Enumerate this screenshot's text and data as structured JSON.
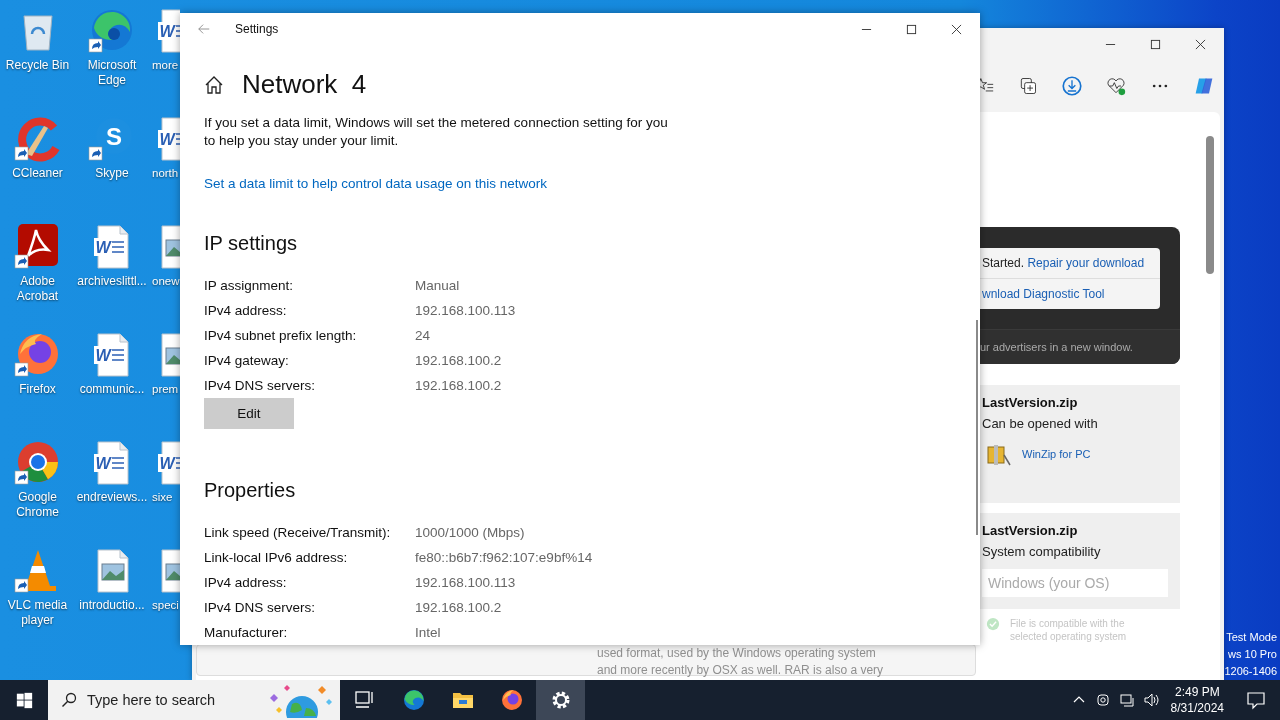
{
  "desktop": {
    "icons": [
      {
        "label": "Recycle Bin",
        "kind": "recycle-bin",
        "shortcut": false
      },
      {
        "label": "Microsoft Edge",
        "kind": "edge",
        "shortcut": true
      },
      {
        "label": "more",
        "kind": "word",
        "shortcut": false,
        "glyph": "W"
      },
      {
        "label": "CCleaner",
        "kind": "ccleaner",
        "shortcut": true
      },
      {
        "label": "Skype",
        "kind": "skype",
        "shortcut": true,
        "glyph": "S"
      },
      {
        "label": "north",
        "kind": "word",
        "shortcut": false,
        "glyph": "W"
      },
      {
        "label": "Adobe Acrobat",
        "kind": "acrobat",
        "shortcut": true
      },
      {
        "label": "archiveslittl...",
        "kind": "word",
        "shortcut": false,
        "glyph": "W"
      },
      {
        "label": "onew",
        "kind": "image",
        "shortcut": false
      },
      {
        "label": "Firefox",
        "kind": "firefox",
        "shortcut": true
      },
      {
        "label": "communic...",
        "kind": "word",
        "shortcut": false,
        "glyph": "W"
      },
      {
        "label": "prem",
        "kind": "image",
        "shortcut": false
      },
      {
        "label": "Google Chrome",
        "kind": "chrome",
        "shortcut": true
      },
      {
        "label": "endreviews...",
        "kind": "word",
        "shortcut": false,
        "glyph": "W"
      },
      {
        "label": "sixe",
        "kind": "word",
        "shortcut": false,
        "glyph": "W"
      },
      {
        "label": "VLC media player",
        "kind": "vlc",
        "shortcut": true
      },
      {
        "label": "introductio...",
        "kind": "image",
        "shortcut": false
      },
      {
        "label": "speci",
        "kind": "image",
        "shortcut": false
      }
    ],
    "system_text": [
      "Test Mode",
      "ws 10 Pro",
      "1206-1406"
    ]
  },
  "browser_window": {
    "toolbar": [
      {
        "kind": "favorites"
      },
      {
        "kind": "collections"
      },
      {
        "kind": "downloads"
      },
      {
        "kind": "health"
      },
      {
        "kind": "more"
      },
      {
        "kind": "copilot"
      }
    ],
    "promo": {
      "text": "Started.",
      "link": "Repair your download",
      "second_link": "wnload Diagnostic Tool",
      "footer": "ur advertisers in a new window."
    },
    "file_card": {
      "name": "LastVersion.zip",
      "subtitle": "Can be opened with",
      "app": "WinZip for PC"
    },
    "compat_card": {
      "name": "LastVersion.zip",
      "subtitle": "System compatibility",
      "select": "Windows (your OS)",
      "note": "File is compatible with the selected operating system"
    },
    "description": [
      "used format, used by the Windows operating system",
      "and more recently by OSX as well. RAR is also a very"
    ]
  },
  "settings_window": {
    "title": "Settings",
    "page_title": "Network  4",
    "intro": "If you set a data limit, Windows will set the metered connection setting for you to help you stay under your limit.",
    "data_limit_link": "Set a data limit to help control data usage on this network",
    "ip_settings": {
      "heading": "IP settings",
      "rows": [
        {
          "label": "IP assignment:",
          "value": "Manual"
        },
        {
          "label": "IPv4 address:",
          "value": "192.168.100.113"
        },
        {
          "label": "IPv4 subnet prefix length:",
          "value": "24"
        },
        {
          "label": "IPv4 gateway:",
          "value": "192.168.100.2"
        },
        {
          "label": "IPv4 DNS servers:",
          "value": "192.168.100.2"
        }
      ],
      "edit_button": "Edit"
    },
    "properties": {
      "heading": "Properties",
      "rows": [
        {
          "label": "Link speed (Receive/Transmit):",
          "value": "1000/1000 (Mbps)"
        },
        {
          "label": "Link-local IPv6 address:",
          "value": "fe80::b6b7:f962:107:e9bf%14"
        },
        {
          "label": "IPv4 address:",
          "value": "192.168.100.113"
        },
        {
          "label": "IPv4 DNS servers:",
          "value": "192.168.100.2"
        },
        {
          "label": "Manufacturer:",
          "value": "Intel"
        }
      ]
    }
  },
  "taskbar": {
    "search_placeholder": "Type here to search",
    "apps": [
      {
        "kind": "task-view",
        "selected": false
      },
      {
        "kind": "edge",
        "selected": false
      },
      {
        "kind": "explorer",
        "selected": false
      },
      {
        "kind": "firefox",
        "selected": false
      },
      {
        "kind": "settings",
        "selected": true
      }
    ],
    "time": "2:49 PM",
    "date": "8/31/2024"
  }
}
